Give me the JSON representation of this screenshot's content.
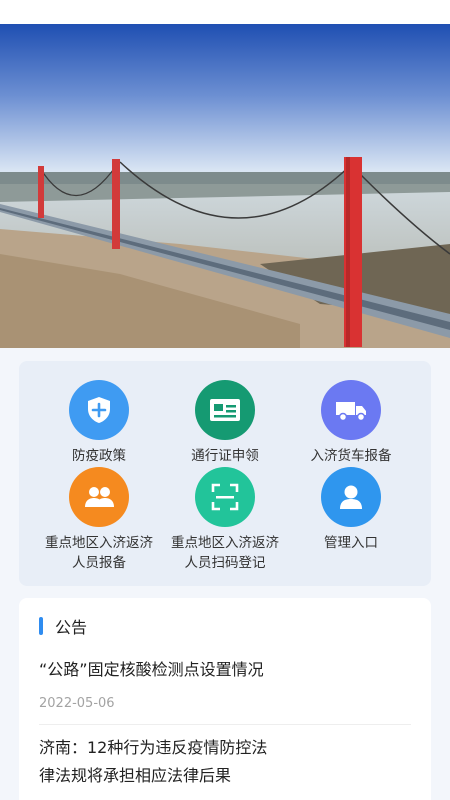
{
  "banner": {
    "alt": "bridge-photo"
  },
  "grid": {
    "items": [
      {
        "label": "防疫政策",
        "icon": "shield-plus-icon",
        "color": "#3f9bf2"
      },
      {
        "label": "通行证申领",
        "icon": "id-card-icon",
        "color": "#159a72"
      },
      {
        "label": "入济货车报备",
        "icon": "truck-icon",
        "color": "#6b79f2"
      },
      {
        "label": "重点地区入济返济人员报备",
        "line1": "重点地区入济返济",
        "line2": "人员报备",
        "icon": "people-icon",
        "color": "#f58a1f"
      },
      {
        "label": "重点地区入济返济人员扫码登记",
        "line1": "重点地区入济返济",
        "line2": "人员扫码登记",
        "icon": "scan-icon",
        "color": "#22c49a"
      },
      {
        "label": "管理入口",
        "icon": "admin-user-icon",
        "color": "#2f96ee"
      }
    ]
  },
  "notice": {
    "title": "公告",
    "items": [
      {
        "title": "“公路”固定核酸检测点设置情况",
        "date": "2022-05-06"
      },
      {
        "line1": "济南：12种行为违反疫情防控法",
        "line2": "律法规将承担相应法律后果"
      }
    ]
  }
}
